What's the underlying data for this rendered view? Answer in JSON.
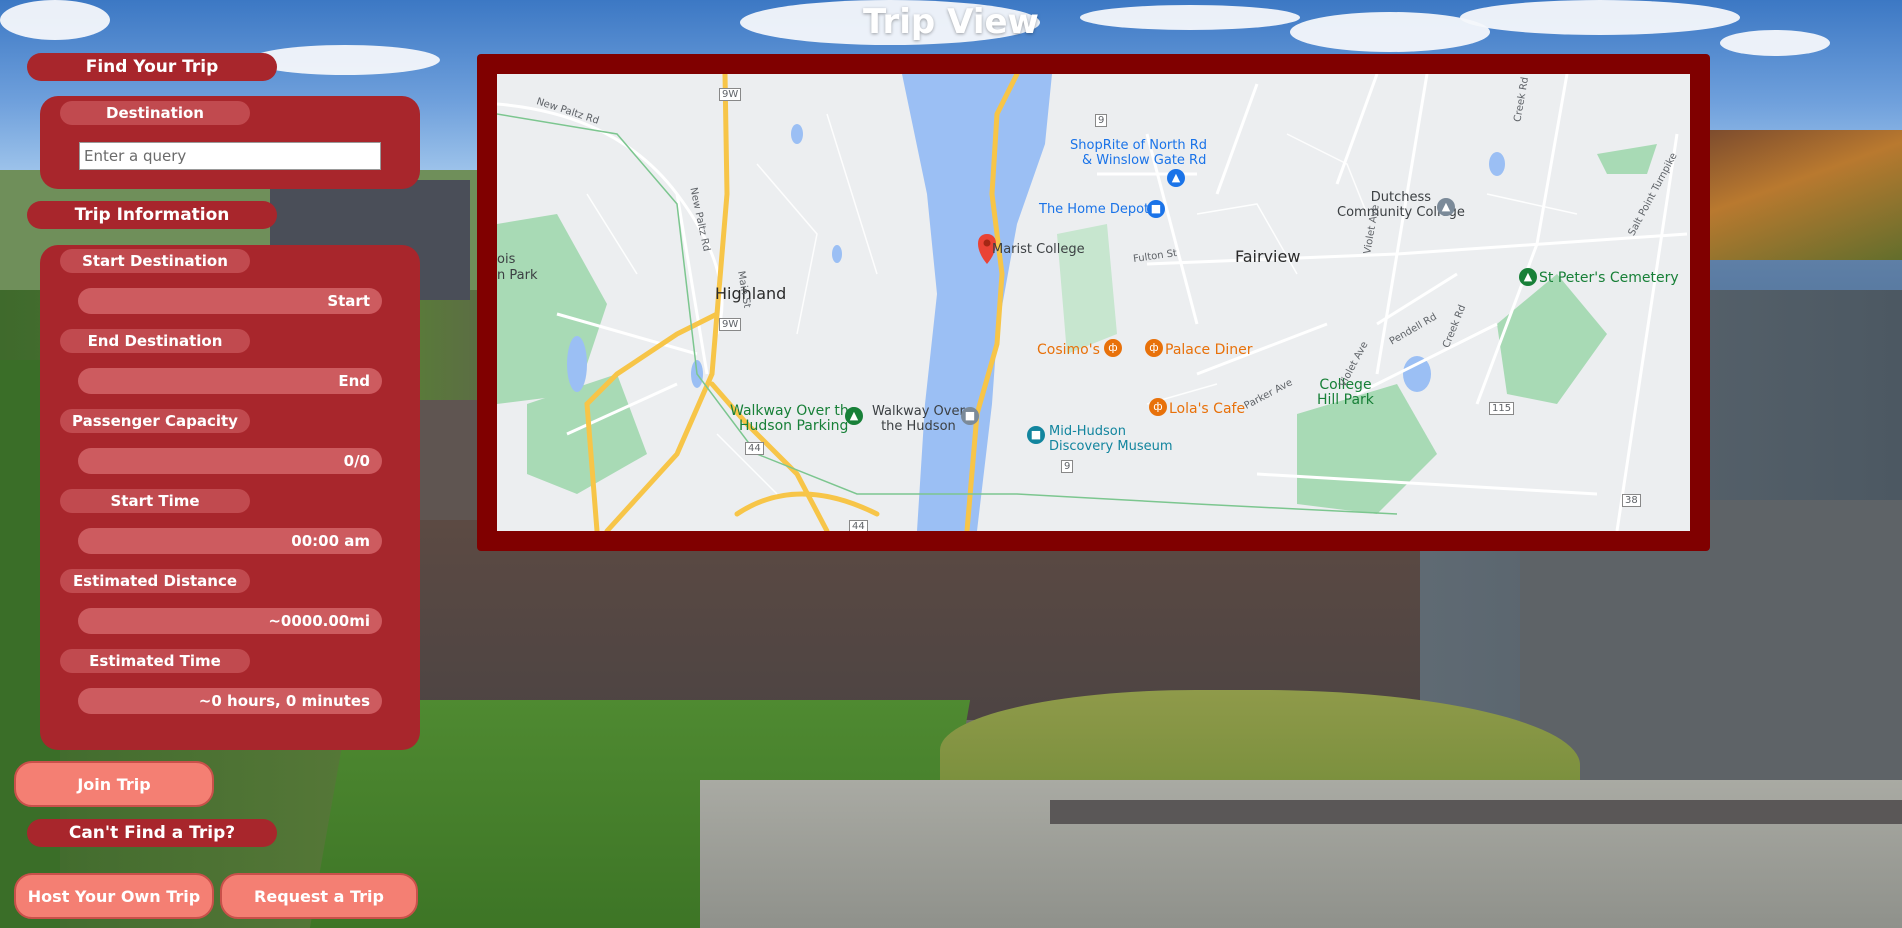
{
  "page": {
    "title": "Trip View"
  },
  "find_trip": {
    "header": "Find Your Trip",
    "destination_label": "Destination",
    "search_value": "",
    "search_placeholder": "Enter a query"
  },
  "trip_info": {
    "header": "Trip Information",
    "fields": [
      {
        "label": "Start Destination",
        "value": "Start"
      },
      {
        "label": "End Destination",
        "value": "End"
      },
      {
        "label": "Passenger Capacity",
        "value": "0/0"
      },
      {
        "label": "Start Time",
        "value": "00:00 am"
      },
      {
        "label": "Estimated Distance",
        "value": "~0000.00mi"
      },
      {
        "label": "Estimated Time",
        "value": "~0 hours, 0 minutes"
      }
    ]
  },
  "actions": {
    "join_label": "Join Trip",
    "cant_find_header": "Can't Find a Trip?",
    "host_label": "Host Your Own Trip",
    "request_label": "Request a Trip"
  },
  "map": {
    "towns": {
      "highland": "Highland",
      "fairview": "Fairview"
    },
    "pois": {
      "shoprite": [
        "ShopRite of North Rd",
        "& Winslow Gate Rd"
      ],
      "home_depot": "The Home Depot",
      "marist": "Marist College",
      "dutchess": [
        "Dutchess",
        "Community College"
      ],
      "st_peters": "St Peter's Cemetery",
      "cosimos": "Cosimo's",
      "palace": "Palace Diner",
      "lolas": "Lola's Cafe",
      "college_hill": [
        "College",
        "Hill Park"
      ],
      "walkway_parking": [
        "Walkway Over the",
        "Hudson Parking"
      ],
      "walkway": [
        "Walkway Over",
        "the Hudson"
      ],
      "mid_hudson": [
        "Mid-Hudson",
        "Discovery Museum"
      ],
      "park_left": [
        "ois",
        "n Park"
      ]
    },
    "roads": {
      "new_paltz_rd": "New Paltz Rd",
      "new_paltz_rd2": "New Paltz Rd",
      "main_st": "Main St",
      "fulton_st": "Fulton St",
      "violet_ave": "Violet Ave",
      "violet_ave2": "Violet Ave",
      "creek_rd": "Creek Rd",
      "creek_rd2": "Creek Rd",
      "pendell_rd": "Pendell Rd",
      "parker_ave": "Parker Ave",
      "salt_point": "Salt Point Turnpike"
    },
    "shields": {
      "r9w_a": "9W",
      "r9w_b": "9W",
      "r9_a": "9",
      "r9_b": "9",
      "r44_a": "44",
      "r44_b": "44",
      "r115": "115",
      "r38": "38"
    },
    "colors": {
      "water": "#9bbff4",
      "park": "#a8dab5",
      "highway": "#f7c548",
      "road": "#ffffff",
      "frame": "#800000"
    }
  },
  "colors": {
    "panel": "#a8262c",
    "pill": "#c14a4f",
    "bar": "#cd5b5f",
    "button": "#f47f73"
  }
}
